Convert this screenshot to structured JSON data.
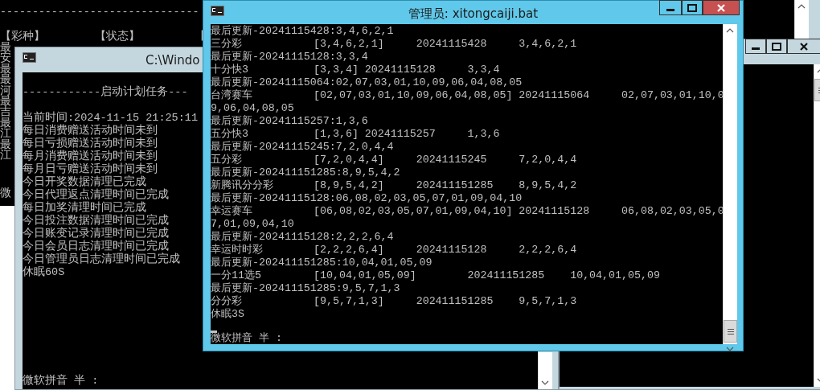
{
  "back_console": {
    "rule": "-------------------------------",
    "headers": [
      "【彩种】",
      "【状态】",
      "【"
    ],
    "row_fragments": [
      "最",
      "安",
      "最",
      "最",
      "河",
      "最",
      "吉",
      "最",
      "江",
      "最",
      "江"
    ],
    "ime_fragment": "微"
  },
  "schedule_window": {
    "title": "C:\\Windo",
    "banner": "------------启动计划任务---",
    "lines": [
      "当前时间:2024-11-15 21:25:11",
      "每日消费赠送活动时间未到",
      "每日亏损赠送活动时间未到",
      "每月消费赠送活动时间未到",
      "每月日亏赠送活动时间未到",
      "今日开奖数据清理已完成",
      "今日代理返点清理时间已完成",
      "每日加奖清理时间已完成",
      "今日投注数据清理时间已完成",
      "今日账变记录清理时间已完成",
      "今日会员日志清理时间已完成",
      "今日管理员日志清理时间已完成",
      "休眠60S"
    ],
    "ime_status": "微软拼音 半 :"
  },
  "collector_window": {
    "title": "管理员: xitongcaiji.bat",
    "lines": [
      {
        "kind": "text",
        "text": "最后更新-20241115428:3,4,6,2,1"
      },
      {
        "kind": "row",
        "name": "三分彩",
        "record": "[3,4,6,2,1]     20241115428     3,4,6,2,1"
      },
      {
        "kind": "text",
        "text": "最后更新-20241115128:3,3,4"
      },
      {
        "kind": "row",
        "name": "十分快3",
        "record": "[3,3,4] 20241115128     3,3,4"
      },
      {
        "kind": "text",
        "text": "最后更新-20241115064:02,07,03,01,10,09,06,04,08,05"
      },
      {
        "kind": "row",
        "name": "台湾赛车",
        "record": "[02,07,03,01,10,09,06,04,08,05] 20241115064     02,07,03,01,10,0"
      },
      {
        "kind": "text",
        "text": "9,06,04,08,05"
      },
      {
        "kind": "text",
        "text": "最后更新-20241115257:1,3,6"
      },
      {
        "kind": "row",
        "name": "五分快3",
        "record": "[1,3,6] 20241115257     1,3,6"
      },
      {
        "kind": "text",
        "text": "最后更新-20241115245:7,2,0,4,4"
      },
      {
        "kind": "row",
        "name": "五分彩",
        "record": "[7,2,0,4,4]     20241115245     7,2,0,4,4"
      },
      {
        "kind": "text",
        "text": "最后更新-202411151285:8,9,5,4,2"
      },
      {
        "kind": "row",
        "name": "新腾讯分分彩",
        "record": "[8,9,5,4,2]     202411151285    8,9,5,4,2"
      },
      {
        "kind": "text",
        "text": "最后更新-20241115128:06,08,02,03,05,07,01,09,04,10"
      },
      {
        "kind": "row",
        "name": "幸运赛车",
        "record": "[06,08,02,03,05,07,01,09,04,10] 20241115128     06,08,02,03,05,0"
      },
      {
        "kind": "text",
        "text": "7,01,09,04,10"
      },
      {
        "kind": "text",
        "text": "最后更新-20241115128:2,2,2,6,4"
      },
      {
        "kind": "row",
        "name": "幸运时时彩",
        "record": "[2,2,2,6,4]     20241115128     2,2,2,6,4"
      },
      {
        "kind": "text",
        "text": "最后更新-202411151285:10,04,01,05,09"
      },
      {
        "kind": "row",
        "name": "一分11选5",
        "record": "[10,04,01,05,09]        202411151285    10,04,01,05,09"
      },
      {
        "kind": "text",
        "text": "最后更新-202411151285:9,5,7,1,3"
      },
      {
        "kind": "row",
        "name": "分分彩",
        "record": "[9,5,7,1,3]     202411151285    9,5,7,1,3"
      },
      {
        "kind": "text",
        "text": "休眠3S"
      }
    ],
    "ime_status": "微软拼音 半 :"
  }
}
